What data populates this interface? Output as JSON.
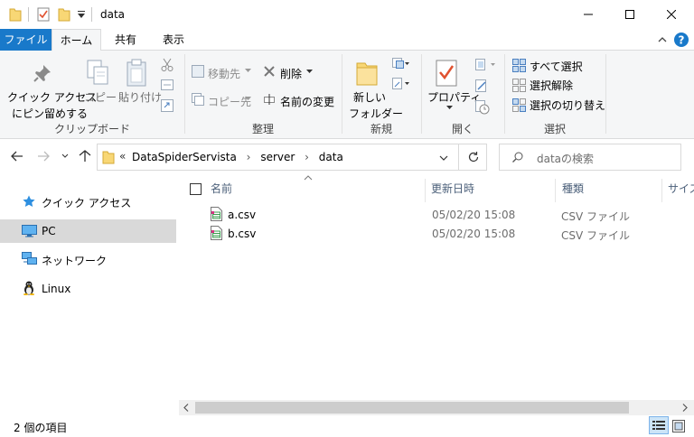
{
  "window": {
    "title": "data"
  },
  "tabs": {
    "file": "ファイル",
    "home": "ホーム",
    "share": "共有",
    "view": "表示"
  },
  "ribbon": {
    "clipboard": {
      "pin_line1": "クイック アクセス",
      "pin_line2": "にピン留めする",
      "copy": "コピー",
      "paste": "貼り付け",
      "group": "クリップボード"
    },
    "organize": {
      "move_to": "移動先",
      "copy_to": "コピー先",
      "delete": "削除",
      "rename": "名前の変更",
      "group": "整理"
    },
    "new": {
      "new_folder_line1": "新しい",
      "new_folder_line2": "フォルダー",
      "group": "新規"
    },
    "open": {
      "properties": "プロパティ",
      "group": "開く"
    },
    "select": {
      "select_all": "すべて選択",
      "select_none": "選択解除",
      "invert": "選択の切り替え",
      "group": "選択"
    }
  },
  "address": {
    "overflow": "«",
    "crumbs": [
      "DataSpiderServista",
      "server",
      "data"
    ],
    "search_placeholder": "dataの検索"
  },
  "nav": {
    "items": [
      {
        "label": "クイック アクセス",
        "icon": "star-icon"
      },
      {
        "label": "PC",
        "icon": "pc-icon",
        "selected": true
      },
      {
        "label": "ネットワーク",
        "icon": "network-icon"
      },
      {
        "label": "Linux",
        "icon": "linux-icon"
      }
    ]
  },
  "list": {
    "columns": {
      "name": "名前",
      "modified": "更新日時",
      "type": "種類",
      "size": "サイズ"
    },
    "files": [
      {
        "name": "a.csv",
        "modified": "05/02/20 15:08",
        "type": "CSV ファイル"
      },
      {
        "name": "b.csv",
        "modified": "05/02/20 15:08",
        "type": "CSV ファイル"
      }
    ]
  },
  "status": {
    "item_count": "2 個の項目"
  },
  "colors": {
    "accent": "#1979ca",
    "folder": "#f8d775",
    "selected": "#d9d9d9"
  }
}
